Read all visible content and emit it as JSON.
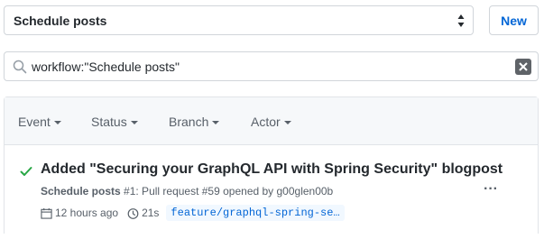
{
  "workflow_select": {
    "label": "Schedule posts"
  },
  "new_button": {
    "label": "New"
  },
  "search": {
    "value": "workflow:\"Schedule posts\""
  },
  "filters": [
    {
      "label": "Event"
    },
    {
      "label": "Status"
    },
    {
      "label": "Branch"
    },
    {
      "label": "Actor"
    }
  ],
  "run": {
    "status": "success",
    "title": "Added \"Securing your GraphQL API with Spring Security\" blogpost",
    "workflow": "Schedule posts",
    "run_number": "#1",
    "description": ": Pull request #59 opened by g00glen00b",
    "time_ago": "12 hours ago",
    "duration": "21s",
    "branch": "feature/graphql-spring-se…"
  },
  "colors": {
    "link_blue": "#0366d6",
    "success_green": "#28a745",
    "muted_text": "#586069"
  }
}
